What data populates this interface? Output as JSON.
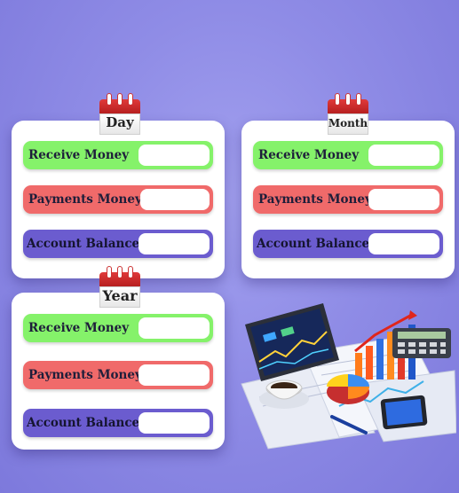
{
  "panels": [
    {
      "id": "day",
      "title": "Day",
      "rows": [
        {
          "label": "Receive Money",
          "value": ""
        },
        {
          "label": "Payments Money",
          "value": ""
        },
        {
          "label": "Account Balance",
          "value": ""
        }
      ]
    },
    {
      "id": "month",
      "title": "Month",
      "rows": [
        {
          "label": "Receive Money",
          "value": ""
        },
        {
          "label": "Payments Money",
          "value": ""
        },
        {
          "label": "Account Balance",
          "value": ""
        }
      ]
    },
    {
      "id": "year",
      "title": "Year",
      "rows": [
        {
          "label": "Receive Money",
          "value": ""
        },
        {
          "label": "Payments Money",
          "value": ""
        },
        {
          "label": "Account Balance",
          "value": ""
        }
      ]
    }
  ],
  "colors": {
    "background": "#8f8ce6",
    "receive": "#85f26a",
    "payments": "#f06a6a",
    "balance": "#6b5ccf",
    "calendar_red": "#d0302f"
  },
  "icons": [
    "calendar-icon",
    "finance-illustration"
  ]
}
